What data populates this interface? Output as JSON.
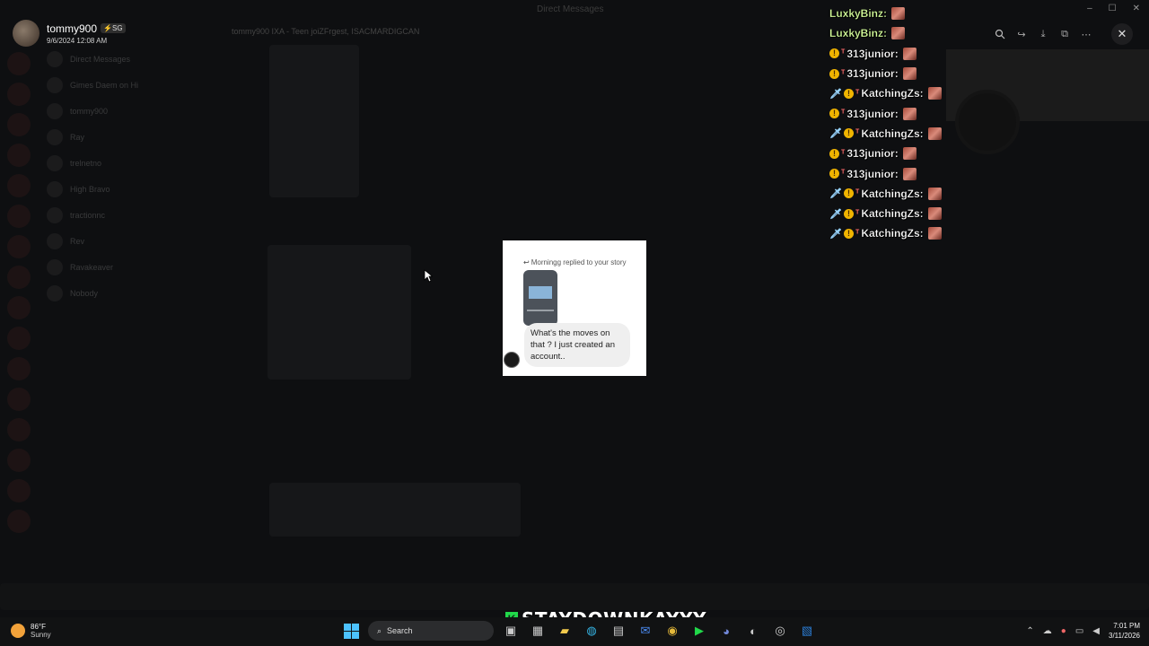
{
  "window": {
    "title": "Direct Messages"
  },
  "profile": {
    "name": "tommy900",
    "badge": "⚡SG",
    "date": "9/6/2024 12:08 AM"
  },
  "dm_list": [
    "Direct Messages",
    "Gimes Daem on Hi",
    "tommy900",
    "Ray",
    "trelnetno",
    "High Bravo",
    "tractionnc",
    "Rev",
    "Ravakeaver",
    "Nobody"
  ],
  "background_header": "tommy900  IXA - Teen joiZFrgest, ISACMARDIGCAN",
  "tools": [
    "zoom-icon",
    "reply-icon",
    "download-icon",
    "open-icon",
    "more-icon"
  ],
  "close_label": "✕",
  "chat_overlay": [
    {
      "badges": [],
      "user": "LuxkyBinz:",
      "color": "green"
    },
    {
      "badges": [],
      "user": "LuxkyBinz:",
      "color": "green"
    },
    {
      "badges": [
        "gold",
        "gem"
      ],
      "user": "313junior:",
      "color": "white"
    },
    {
      "badges": [
        "gold",
        "gem"
      ],
      "user": "313junior:",
      "color": "white"
    },
    {
      "badges": [
        "sword",
        "gold",
        "gem"
      ],
      "user": "KatchingZs:",
      "color": "white"
    },
    {
      "badges": [
        "gold",
        "gem"
      ],
      "user": "313junior:",
      "color": "white"
    },
    {
      "badges": [
        "sword",
        "gold",
        "gem"
      ],
      "user": "KatchingZs:",
      "color": "white"
    },
    {
      "badges": [
        "gold",
        "gem"
      ],
      "user": "313junior:",
      "color": "white"
    },
    {
      "badges": [
        "gold",
        "gem"
      ],
      "user": "313junior:",
      "color": "white"
    },
    {
      "badges": [
        "sword",
        "gold",
        "gem"
      ],
      "user": "KatchingZs:",
      "color": "white"
    },
    {
      "badges": [
        "sword",
        "gold",
        "gem"
      ],
      "user": "KatchingZs:",
      "color": "white"
    },
    {
      "badges": [
        "sword",
        "gold",
        "gem"
      ],
      "user": "KatchingZs:",
      "color": "white"
    }
  ],
  "viewer": {
    "reply_header": "Morningg replied to your story",
    "message": "What's the moves on that ? I just created an account.."
  },
  "streamer": {
    "logo": "K",
    "name": "STAYDOWNKAYYY"
  },
  "taskbar": {
    "temp": "86°F",
    "condition": "Sunny",
    "search_label": "Search",
    "time": "7:01 PM",
    "date": "3/11/2026"
  }
}
